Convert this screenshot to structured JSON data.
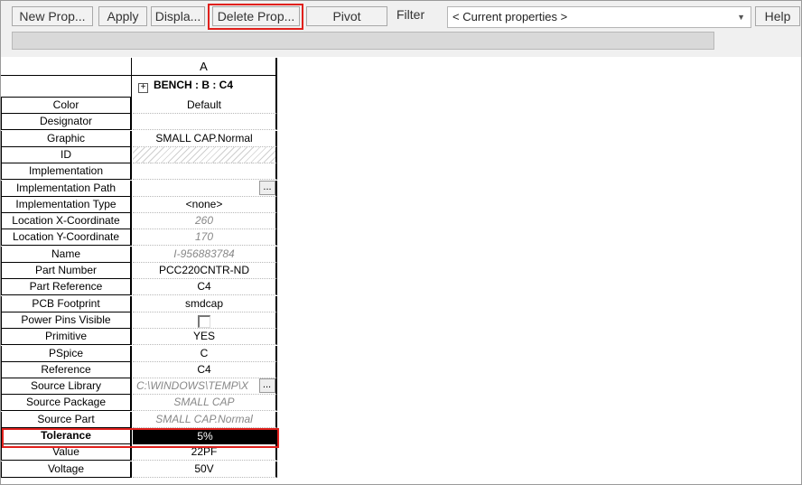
{
  "toolbar": {
    "new_prop": "New Prop...",
    "apply": "Apply",
    "display": "Displa...",
    "delete_prop": "Delete Prop...",
    "pivot": "Pivot",
    "filter_label": "Filter",
    "filter_value": "< Current properties >",
    "help": "Help",
    "highlight_color": "#e0201c"
  },
  "grid": {
    "column_header": "A",
    "object_title": "BENCH : B : C4",
    "rows": [
      {
        "label": "Color",
        "value": "Default"
      },
      {
        "label": "Designator",
        "value": ""
      },
      {
        "label": "Graphic",
        "value": "SMALL CAP.Normal"
      },
      {
        "label": "ID",
        "value": ""
      },
      {
        "label": "Implementation",
        "value": ""
      },
      {
        "label": "Implementation Path",
        "value": "",
        "button": "..."
      },
      {
        "label": "Implementation Type",
        "value": "<none>"
      },
      {
        "label": "Location X-Coordinate",
        "value": "260"
      },
      {
        "label": "Location Y-Coordinate",
        "value": "170"
      },
      {
        "label": "Name",
        "value": "I-956883784"
      },
      {
        "label": "Part Number",
        "value": "PCC220CNTR-ND"
      },
      {
        "label": "Part Reference",
        "value": "C4"
      },
      {
        "label": "PCB Footprint",
        "value": "smdcap"
      },
      {
        "label": "Power Pins Visible",
        "value": ""
      },
      {
        "label": "Primitive",
        "value": "YES"
      },
      {
        "label": "PSpice",
        "value": "C"
      },
      {
        "label": "Reference",
        "value": "C4"
      },
      {
        "label": "Source Library",
        "value": "C:\\WINDOWS\\TEMP\\X",
        "button": "..."
      },
      {
        "label": "Source Package",
        "value": "SMALL CAP"
      },
      {
        "label": "Source Part",
        "value": "SMALL CAP.Normal"
      },
      {
        "label": "Tolerance",
        "value": "5%"
      },
      {
        "label": "Value",
        "value": "22PF"
      },
      {
        "label": "Voltage",
        "value": "50V"
      }
    ]
  }
}
